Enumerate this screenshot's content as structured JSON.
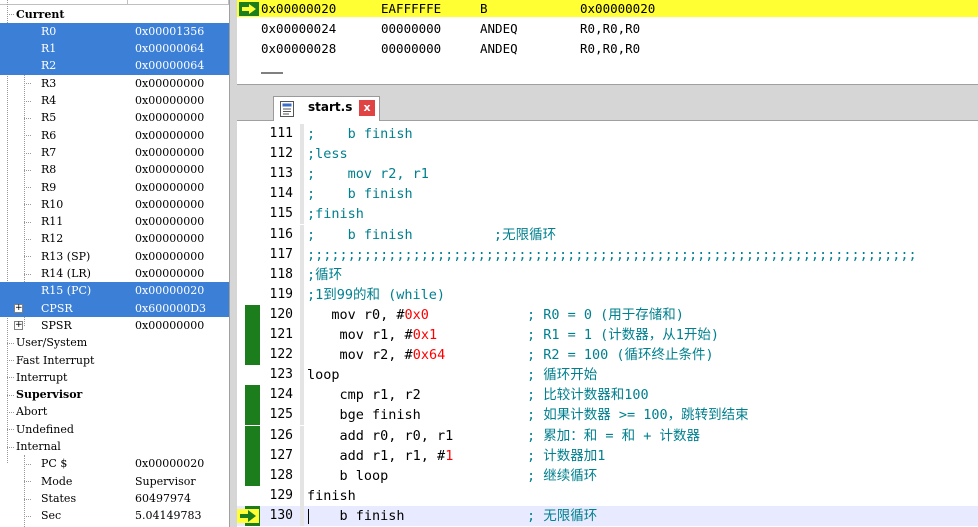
{
  "registers": {
    "header": "Current",
    "current": [
      {
        "name": "R0",
        "value": "0x00001356",
        "selected": true
      },
      {
        "name": "R1",
        "value": "0x00000064",
        "selected": true
      },
      {
        "name": "R2",
        "value": "0x00000064",
        "selected": true
      },
      {
        "name": "R3",
        "value": "0x00000000",
        "selected": false
      },
      {
        "name": "R4",
        "value": "0x00000000",
        "selected": false
      },
      {
        "name": "R5",
        "value": "0x00000000",
        "selected": false
      },
      {
        "name": "R6",
        "value": "0x00000000",
        "selected": false
      },
      {
        "name": "R7",
        "value": "0x00000000",
        "selected": false
      },
      {
        "name": "R8",
        "value": "0x00000000",
        "selected": false
      },
      {
        "name": "R9",
        "value": "0x00000000",
        "selected": false
      },
      {
        "name": "R10",
        "value": "0x00000000",
        "selected": false
      },
      {
        "name": "R11",
        "value": "0x00000000",
        "selected": false
      },
      {
        "name": "R12",
        "value": "0x00000000",
        "selected": false
      },
      {
        "name": "R13 (SP)",
        "value": "0x00000000",
        "selected": false
      },
      {
        "name": "R14 (LR)",
        "value": "0x00000000",
        "selected": false
      },
      {
        "name": "R15 (PC)",
        "value": "0x00000020",
        "selected": true
      },
      {
        "name": "CPSR",
        "value": "0x600000D3",
        "selected": true
      },
      {
        "name": "SPSR",
        "value": "0x00000000",
        "selected": false
      }
    ],
    "expander_symbol": "+",
    "modes": [
      "User/System",
      "Fast Interrupt",
      "Interrupt",
      "Supervisor",
      "Abort",
      "Undefined"
    ],
    "internal": {
      "label": "Internal",
      "items": [
        {
          "name": "PC  $",
          "value": "0x00000020"
        },
        {
          "name": "Mode",
          "value": "Supervisor"
        },
        {
          "name": "States",
          "value": "60497974"
        },
        {
          "name": "Sec",
          "value": "5.04149783"
        }
      ]
    }
  },
  "disassembly": {
    "rows": [
      {
        "address": "0x00000020",
        "opcode": "EAFFFFFE",
        "mnemonic": "B",
        "operands": "0x00000020",
        "current": true
      },
      {
        "address": "0x00000024",
        "opcode": "00000000",
        "mnemonic": "ANDEQ",
        "operands": "R0,R0,R0",
        "current": false
      },
      {
        "address": "0x00000028",
        "opcode": "00000000",
        "mnemonic": "ANDEQ",
        "operands": "R0,R0,R0",
        "current": false
      }
    ]
  },
  "editor": {
    "tab": {
      "title": "start.s",
      "close_symbol": "x"
    },
    "lines": [
      {
        "num": "111",
        "code": ";    b finish",
        "comment": "",
        "exec": false,
        "current": false
      },
      {
        "num": "112",
        "code": ";less",
        "comment": "",
        "exec": false,
        "current": false
      },
      {
        "num": "113",
        "code": ";    mov r2, r1",
        "comment": "",
        "exec": false,
        "current": false
      },
      {
        "num": "114",
        "code": ";    b finish",
        "comment": "",
        "exec": false,
        "current": false
      },
      {
        "num": "115",
        "code": ";finish",
        "comment": "",
        "exec": false,
        "current": false
      },
      {
        "num": "116",
        "code": ";    b finish          ;无限循环",
        "comment": "",
        "exec": false,
        "current": false
      },
      {
        "num": "117",
        "code": ";;;;;;;;;;;;;;;;;;;;;;;;;;;;;;;;;;;;;;;;;;;;;;;;;;;;;;;;;;;;;;;;;;;;;;;;;;;",
        "comment": "",
        "exec": false,
        "current": false
      },
      {
        "num": "118",
        "code": ";循环",
        "comment": "",
        "exec": false,
        "current": false
      },
      {
        "num": "119",
        "code": ";1到99的和 (while)",
        "comment": "",
        "exec": false,
        "current": false
      },
      {
        "num": "120",
        "code": "   mov r0, #0x0",
        "comment": "; R0 = 0 (用于存储和)",
        "exec": true,
        "current": false
      },
      {
        "num": "121",
        "code": "    mov r1, #0x1",
        "comment": "; R1 = 1 (计数器，从1开始)",
        "exec": true,
        "current": false
      },
      {
        "num": "122",
        "code": "    mov r2, #0x64",
        "comment": "; R2 = 100 (循环终止条件)",
        "exec": true,
        "current": false
      },
      {
        "num": "123",
        "code": "loop",
        "comment": "; 循环开始",
        "exec": false,
        "current": false
      },
      {
        "num": "124",
        "code": "    cmp r1, r2",
        "comment": "; 比较计数器和100",
        "exec": true,
        "current": false
      },
      {
        "num": "125",
        "code": "    bge finish",
        "comment": "; 如果计数器 >= 100，跳转到结束",
        "exec": true,
        "current": false
      },
      {
        "num": "126",
        "code": "    add r0, r0, r1",
        "comment": "; 累加：和 = 和 + 计数器",
        "exec": true,
        "current": false
      },
      {
        "num": "127",
        "code": "    add r1, r1, #1",
        "comment": "; 计数器加1",
        "exec": true,
        "current": false
      },
      {
        "num": "128",
        "code": "    b loop",
        "comment": "; 继续循环",
        "exec": true,
        "current": false
      },
      {
        "num": "129",
        "code": "finish",
        "comment": "",
        "exec": false,
        "current": false
      },
      {
        "num": "130",
        "code": "    b finish",
        "comment": "; 无限循环",
        "exec": true,
        "current": true
      }
    ]
  },
  "colors": {
    "selection": "#3c7fd6",
    "current_disasm": "#ffff33",
    "exec_marker": "#1c7d1c",
    "comment": "#00808f",
    "number": "#ff0000",
    "keyword": "#000000"
  }
}
